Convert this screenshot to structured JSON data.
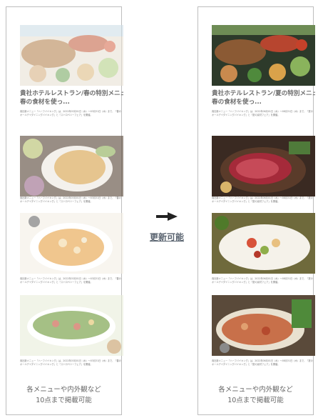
{
  "panel_before": {
    "title_lines": [
      "貴社ホテルレストラン/春の特別メニュー",
      "春の食材を使っ..."
    ],
    "body_text": "貴社新メニュー『ハーフバイキング』は、2022年03月01日（水）〜03月31日（木）まで、『春のオールデイダイニングバイキング』と『ストロベリーフェア』を開催。",
    "short_text": "貴社新メニュー『ハーフバイキング』は、2022年03月01日（水）〜03月31日（木）まで、『春のオールデイダイニングバイキング』と『ストロベリーフェア』を開催。",
    "caption_lines": [
      "各メニューや内外観など",
      "10点まで掲載可能"
    ]
  },
  "panel_after": {
    "title_lines": [
      "貴社ホテルレストラン/夏の特別メニュー",
      "春の食材を使っ..."
    ],
    "body_text": "貴社新メニュー『ハーフバイキング』は、2022年06月01日（水）〜08月31日（木）まで、『夏のオールデイダイニングバイキング』と『夏の素材フェア』を開催。",
    "short_text": "貴社新メニュー『ハーフバイキング』は、2022年06月01日（水）〜08月31日（木）まで、『夏のオールデイダイニングバイキング』と『夏の素材フェア』を開催。",
    "caption_lines": [
      "各メニューや内外観など",
      "10点まで掲載可能"
    ]
  },
  "middle": {
    "update_label": "更新可能",
    "arrow_icon": "right-arrow-icon"
  },
  "colors": {
    "border": "#bdbdbd",
    "text": "#666666",
    "label": "#5a6470"
  }
}
